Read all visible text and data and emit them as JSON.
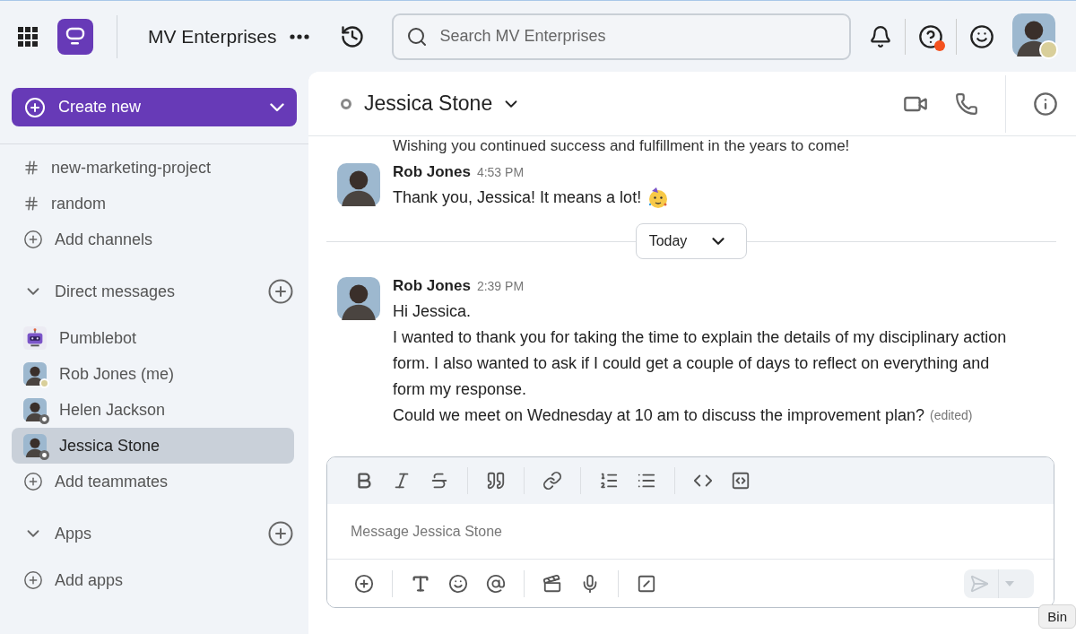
{
  "topbar": {
    "workspace": "MV Enterprises",
    "search": {
      "placeholder": "Search MV Enterprises"
    },
    "help_badge": true,
    "user_away": true
  },
  "sidebar": {
    "create_button": "Create new",
    "channels": [
      {
        "name": "new-marketing-project",
        "selected": false
      },
      {
        "name": "random",
        "selected": false
      }
    ],
    "add_channels": "Add channels",
    "direct_messages": {
      "title": "Direct messages",
      "expanded": true,
      "items": [
        {
          "name": "Pumblebot",
          "kind": "bot",
          "selected": false
        },
        {
          "name": "Rob Jones (me)",
          "kind": "person",
          "away": true,
          "offline": false,
          "selected": false
        },
        {
          "name": "Helen Jackson",
          "kind": "person",
          "away": false,
          "offline": true,
          "selected": false
        },
        {
          "name": "Jessica Stone",
          "kind": "person",
          "away": false,
          "offline": true,
          "selected": true
        }
      ],
      "add": "Add teammates"
    },
    "apps": {
      "title": "Apps",
      "expanded": true,
      "add": "Add apps"
    }
  },
  "chat": {
    "title": "Jessica Stone",
    "offline": true,
    "messages": [
      {
        "kind": "partial",
        "text": "Wishing you continued success and fulfillment in the years to come!"
      },
      {
        "kind": "message",
        "author": "Rob Jones",
        "time": "4:53 PM",
        "lines": [
          "Thank you, Jessica! It means a lot!"
        ],
        "emoji": true
      },
      {
        "kind": "divider",
        "label": "Today"
      },
      {
        "kind": "message",
        "author": "Rob Jones",
        "time": "2:39 PM",
        "lines": [
          "Hi Jessica.",
          "I wanted to thank you for taking the time to explain the details of my disciplinary action form. I also wanted to ask if I could get a couple of days to reflect on everything and form my response.",
          "Could we meet on Wednesday at 10 am to discuss the improvement plan?"
        ],
        "edited": "(edited)"
      }
    ],
    "composer": {
      "placeholder": "Message Jessica Stone"
    }
  },
  "tooltip": "Bin"
}
